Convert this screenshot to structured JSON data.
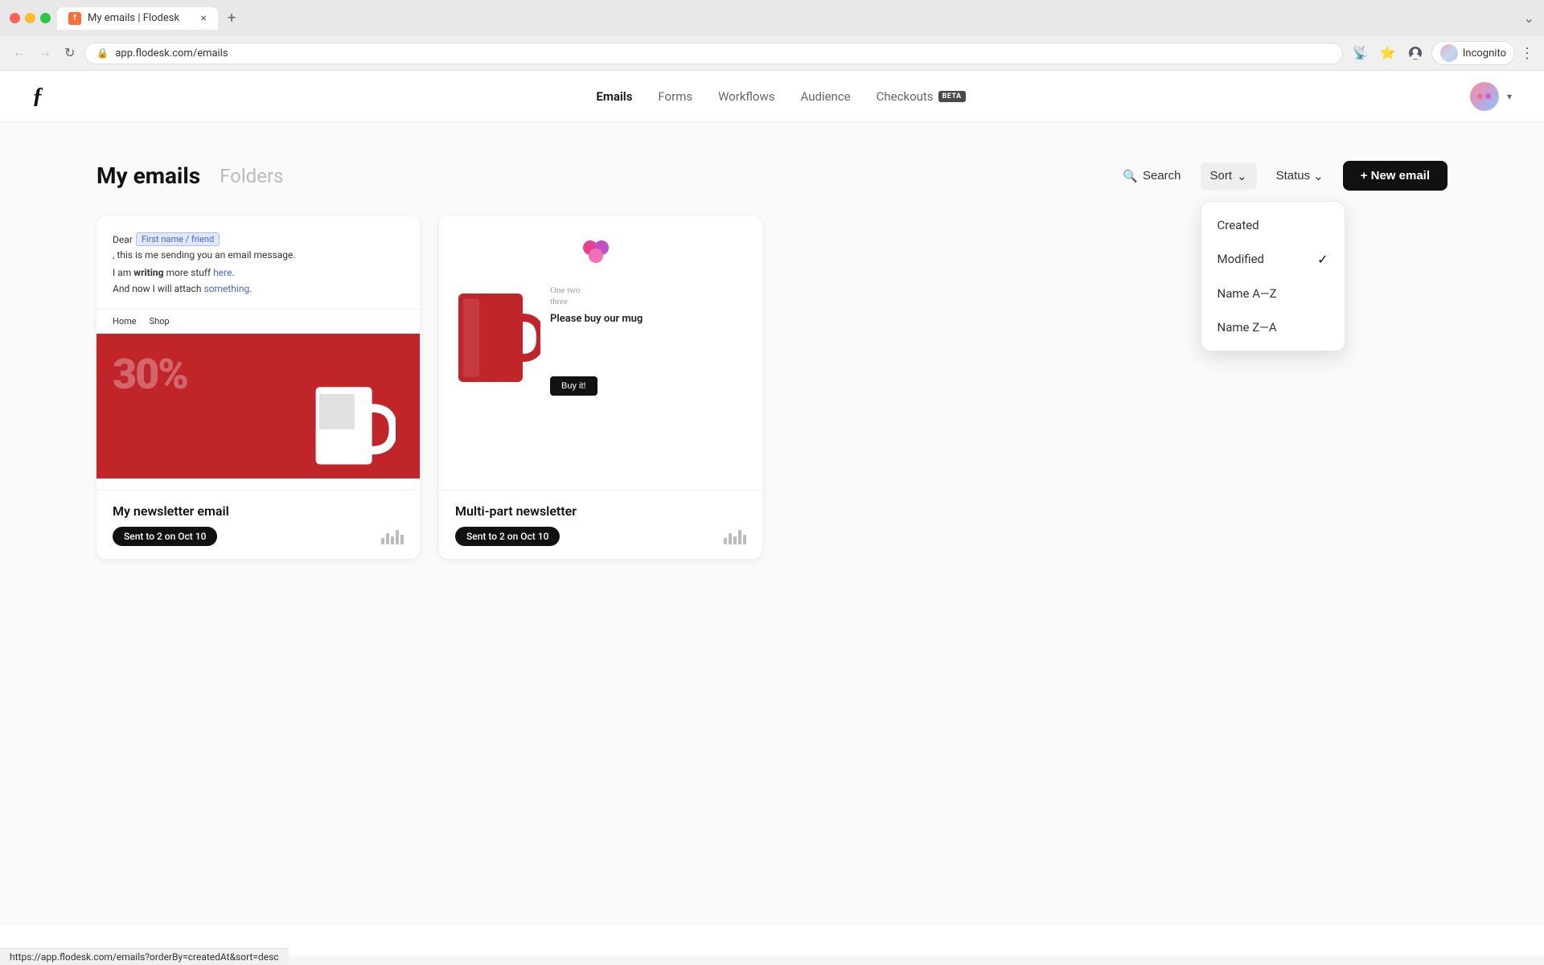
{
  "browser": {
    "tab_title": "My emails | Flodesk",
    "tab_favicon": "f",
    "close_icon": "×",
    "new_tab_icon": "+",
    "expand_icon": "⌄",
    "back_icon": "←",
    "forward_icon": "→",
    "refresh_icon": "↻",
    "address": "app.flodesk.com/emails",
    "more_icon": "⋮",
    "incognito_label": "Incognito",
    "status_url": "https://app.flodesk.com/emails?orderBy=createdAt&sort=desc"
  },
  "app": {
    "logo": "ƒ",
    "nav": {
      "items": [
        {
          "id": "emails",
          "label": "Emails",
          "active": true
        },
        {
          "id": "forms",
          "label": "Forms",
          "active": false
        },
        {
          "id": "workflows",
          "label": "Workflows",
          "active": false
        },
        {
          "id": "audience",
          "label": "Audience",
          "active": false
        },
        {
          "id": "checkouts",
          "label": "Checkouts",
          "active": false,
          "badge": "BETA"
        }
      ]
    }
  },
  "page": {
    "title": "My emails",
    "folders_label": "Folders",
    "search_label": "Search",
    "sort_label": "Sort",
    "status_label": "Status",
    "new_email_label": "+ New email",
    "sort_dropdown": {
      "items": [
        {
          "id": "created",
          "label": "Created",
          "selected": false
        },
        {
          "id": "modified",
          "label": "Modified",
          "selected": true
        },
        {
          "id": "name-az",
          "label": "Name A—Z",
          "selected": false
        },
        {
          "id": "name-za",
          "label": "Name Z—A",
          "selected": false
        }
      ]
    }
  },
  "emails": [
    {
      "id": "email-1",
      "title": "My newsletter email",
      "sent_badge": "Sent to 2 on Oct 10",
      "type": "newsletter"
    },
    {
      "id": "email-2",
      "title": "Multi-part newsletter",
      "sent_badge": "Sent to 2 on Oct 10",
      "type": "multipart"
    }
  ],
  "icons": {
    "search": "🔍",
    "chevron_down": "⌄",
    "check": "✓",
    "plus": "+"
  }
}
